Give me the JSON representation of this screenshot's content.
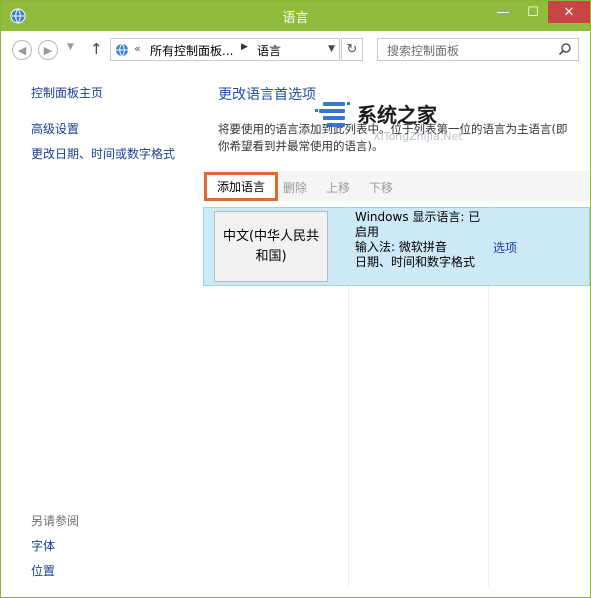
{
  "window": {
    "title": "语言",
    "accent": "#8fbc3b",
    "controls": {
      "minimize": "—",
      "maximize": "☐",
      "close": "✕"
    }
  },
  "address_bar": {
    "segments": [
      "所有控制面板...",
      "语言"
    ],
    "search_placeholder": "搜索控制面板"
  },
  "sidebar": {
    "home_link": "控制面板主页",
    "links": [
      "高级设置",
      "更改日期、时间或数字格式"
    ],
    "see_also_heading": "另请参阅",
    "see_also": [
      "字体",
      "位置"
    ]
  },
  "main": {
    "title": "更改语言首选项",
    "description": "将要使用的语言添加到此列表中。位于列表第一位的语言为主语言(即你希望看到并最常使用的语言)。",
    "toolbar": {
      "add": "添加语言",
      "remove": "删除",
      "up": "上移",
      "down": "下移"
    },
    "languages": [
      {
        "name": "中文(中华人民共和国)",
        "details": [
          "Windows 显示语言: 已启用",
          "输入法: 微软拼音",
          "日期、时间和数字格式"
        ],
        "options": "选项"
      }
    ]
  },
  "watermark": {
    "brand": "系统之家",
    "url": "XiTongZhiJia.Net"
  }
}
